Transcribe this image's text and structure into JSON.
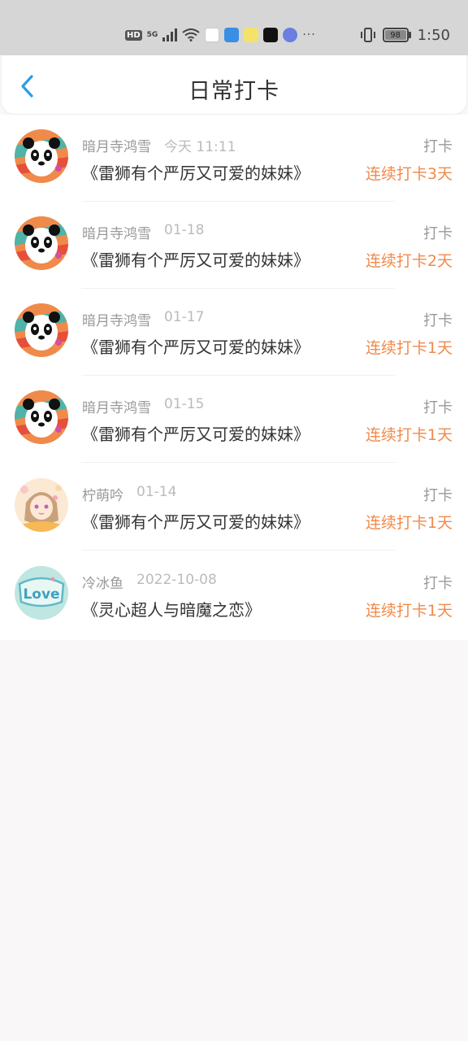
{
  "status_bar": {
    "hd": "HD",
    "network": "5G",
    "battery": "98",
    "time": "1:50",
    "more": "···"
  },
  "nav": {
    "title": "日常打卡",
    "back_icon": "chevron-left-icon",
    "accent": "#2b9de9"
  },
  "records": [
    {
      "user": "暗月寺鸿雪",
      "date": "今天 11:11",
      "book": "《雷狮有个严厉又可爱的妹妹》",
      "action": "打卡",
      "streak": "连续打卡3天",
      "avatar": "panda"
    },
    {
      "user": "暗月寺鸿雪",
      "date": "01-18",
      "book": "《雷狮有个严厉又可爱的妹妹》",
      "action": "打卡",
      "streak": "连续打卡2天",
      "avatar": "panda"
    },
    {
      "user": "暗月寺鸿雪",
      "date": "01-17",
      "book": "《雷狮有个严厉又可爱的妹妹》",
      "action": "打卡",
      "streak": "连续打卡1天",
      "avatar": "panda"
    },
    {
      "user": "暗月寺鸿雪",
      "date": "01-15",
      "book": "《雷狮有个严厉又可爱的妹妹》",
      "action": "打卡",
      "streak": "连续打卡1天",
      "avatar": "panda"
    },
    {
      "user": "柠萌吟",
      "date": "01-14",
      "book": "《雷狮有个严厉又可爱的妹妹》",
      "action": "打卡",
      "streak": "连续打卡1天",
      "avatar": "anime-girl"
    },
    {
      "user": "冷冰鱼",
      "date": "2022-10-08",
      "book": "《灵心超人与暗魔之恋》",
      "action": "打卡",
      "streak": "连续打卡1天",
      "avatar": "love-badge",
      "avatar_text": "Love"
    }
  ],
  "colors": {
    "streak": "#f08a4b",
    "background": "#f9f7f7"
  }
}
